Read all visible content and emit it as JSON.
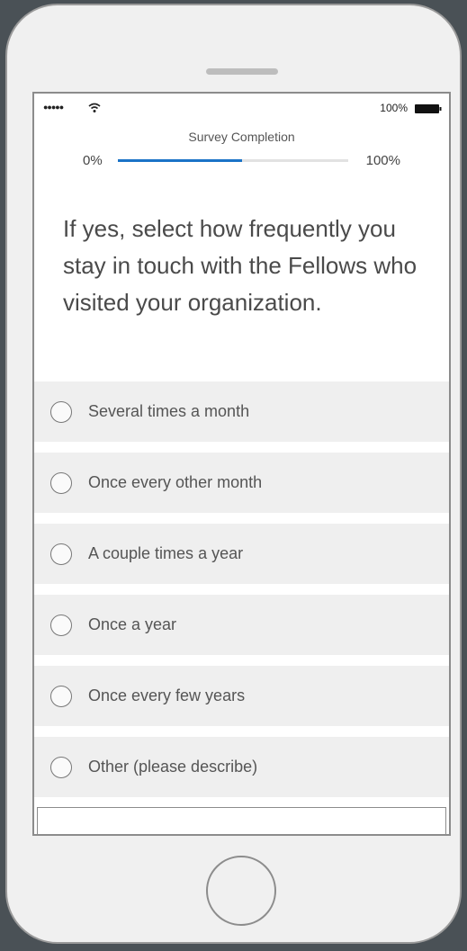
{
  "status_bar": {
    "signal": "●●●●●",
    "battery_percent": "100%"
  },
  "progress": {
    "title": "Survey Completion",
    "start_label": "0%",
    "end_label": "100%",
    "fraction": 0.54,
    "fill_color": "#1a73c7"
  },
  "question": {
    "text": "If yes, select how frequently you stay in touch with the Fellows who visited your organization."
  },
  "options": [
    {
      "label": "Several times a month"
    },
    {
      "label": "Once every other month"
    },
    {
      "label": "A couple times a year"
    },
    {
      "label": "Once a year"
    },
    {
      "label": "Once every few years"
    },
    {
      "label": "Other (please describe)"
    }
  ]
}
